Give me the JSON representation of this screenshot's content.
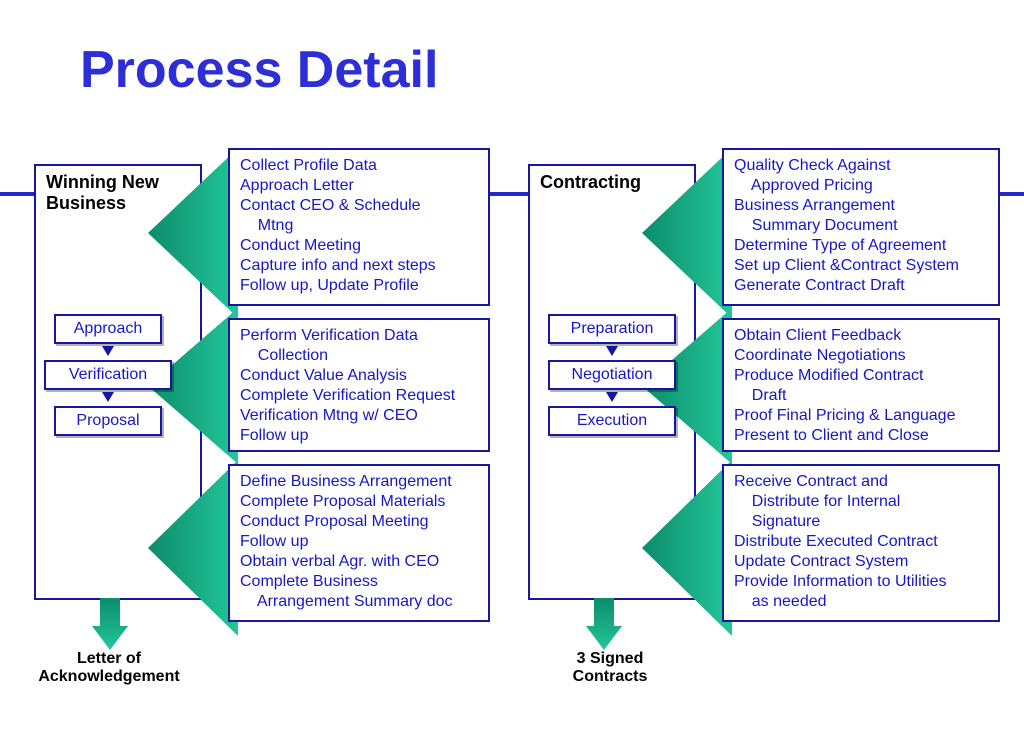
{
  "title": "Process Detail",
  "stages": [
    {
      "title": "Winning New Business",
      "steps": [
        "Approach",
        "Verification",
        "Proposal"
      ],
      "output": "Letter of\nAcknowledgement",
      "details": [
        [
          "Collect Profile Data",
          "Approach Letter",
          "Contact CEO & Schedule",
          "    Mtng",
          "Conduct Meeting",
          "Capture info and next steps",
          "Follow up, Update Profile"
        ],
        [
          "Perform Verification Data",
          "    Collection",
          "Conduct Value Analysis",
          "Complete Verification Request",
          "Verification Mtng w/ CEO",
          "Follow up"
        ],
        [
          "Define Business Arrangement",
          "Complete Proposal Materials",
          "Conduct Proposal Meeting",
          "Follow up",
          "Obtain verbal Agr. with CEO",
          "Complete Business",
          "    Arrangement Summary doc"
        ]
      ]
    },
    {
      "title": "Contracting",
      "steps": [
        "Preparation",
        "Negotiation",
        "Execution"
      ],
      "output": "3 Signed\nContracts",
      "details": [
        [
          "Quality Check Against",
          "    Approved Pricing",
          "Business Arrangement",
          "    Summary Document",
          "Determine Type of Agreement",
          "Set up Client &Contract System",
          "Generate Contract Draft"
        ],
        [
          "Obtain Client Feedback",
          "Coordinate Negotiations",
          "Produce Modified Contract",
          "    Draft",
          "Proof Final Pricing & Language",
          "Present to Client and Close"
        ],
        [
          "Receive Contract and",
          "    Distribute for Internal",
          "    Signature",
          "Distribute Executed Contract",
          "Update Contract System",
          "Provide Information to Utilities",
          "    as needed"
        ]
      ]
    }
  ]
}
